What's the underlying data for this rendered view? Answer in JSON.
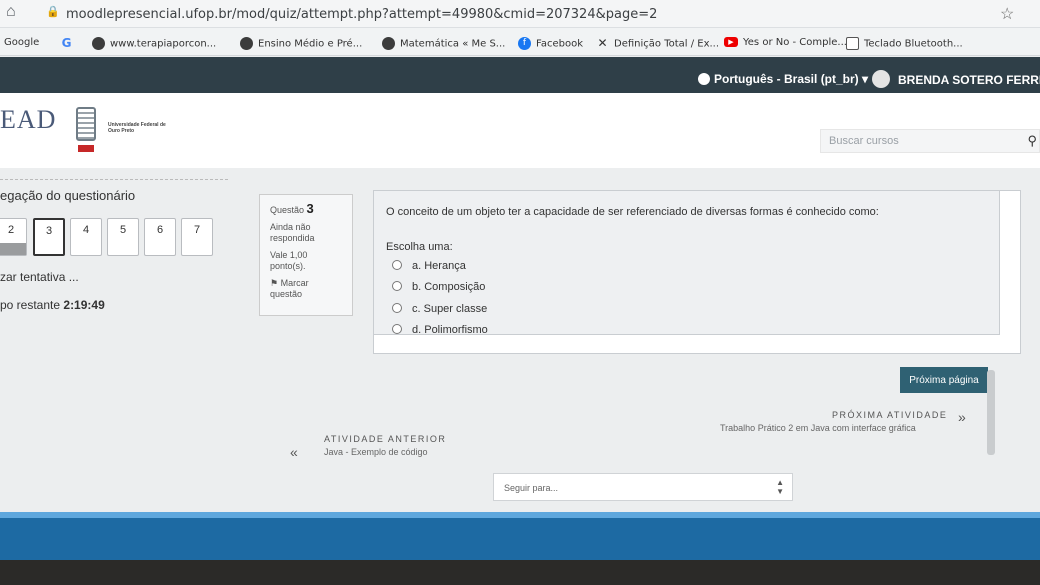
{
  "browser": {
    "url": "moodlepresencial.ufop.br/mod/quiz/attempt.php?attempt=49980&cmid=207324&page=2",
    "bookmarks": [
      {
        "label": "Google",
        "icon": "google-icon"
      },
      {
        "label": "G",
        "icon": "g-icon"
      },
      {
        "label": "www.terapiaporcon...",
        "icon": "globe-icon"
      },
      {
        "label": "Ensino Médio e Pré...",
        "icon": "globe-icon"
      },
      {
        "label": "Matemática « Me S...",
        "icon": "globe-icon"
      },
      {
        "label": "Facebook",
        "icon": "facebook-icon"
      },
      {
        "label": "Definição Total / Ex...",
        "icon": "x-icon"
      },
      {
        "label": "Yes or No - Comple...",
        "icon": "youtube-icon"
      },
      {
        "label": "Teclado Bluetooth...",
        "icon": "doc-icon"
      }
    ]
  },
  "navbar": {
    "language": "Português - Brasil (pt_br) ▾",
    "user": "BRENDA SOTERO FERREIRA"
  },
  "header": {
    "logo": "EAD",
    "university": "Universidade Federal de Ouro Preto",
    "search_placeholder": "Buscar cursos"
  },
  "quiz_nav": {
    "title": "egação do questionário",
    "questions": [
      "2",
      "3",
      "4",
      "5",
      "6",
      "7"
    ],
    "current": "3",
    "finish_label": "zar tentativa ...",
    "time_label": "po restante",
    "time_value": "2:19:49"
  },
  "question_info": {
    "label": "Questão",
    "number": "3",
    "status": "Ainda não respondida",
    "points": "Vale 1,00 ponto(s).",
    "flag": "Marcar questão"
  },
  "question": {
    "text": "O conceito de um objeto ter a capacidade de ser referenciado de diversas formas é conhecido como:",
    "prompt": "Escolha uma:",
    "options": [
      "a. Herança",
      "b. Composição",
      "c. Super classe",
      "d. Polimorfismo"
    ]
  },
  "footer": {
    "next_page": "Próxima página",
    "prev_activity_label": "ATIVIDADE ANTERIOR",
    "prev_activity": "Java - Exemplo de código",
    "next_activity_label": "PRÓXIMA ATIVIDADE",
    "next_activity": "Trabalho Prático 2 em Java com interface gráfica",
    "jump_placeholder": "Seguir para..."
  },
  "colors": {
    "navbar": "#2f3f48",
    "button": "#2f6173",
    "taskbar": "#1d6aa3"
  }
}
